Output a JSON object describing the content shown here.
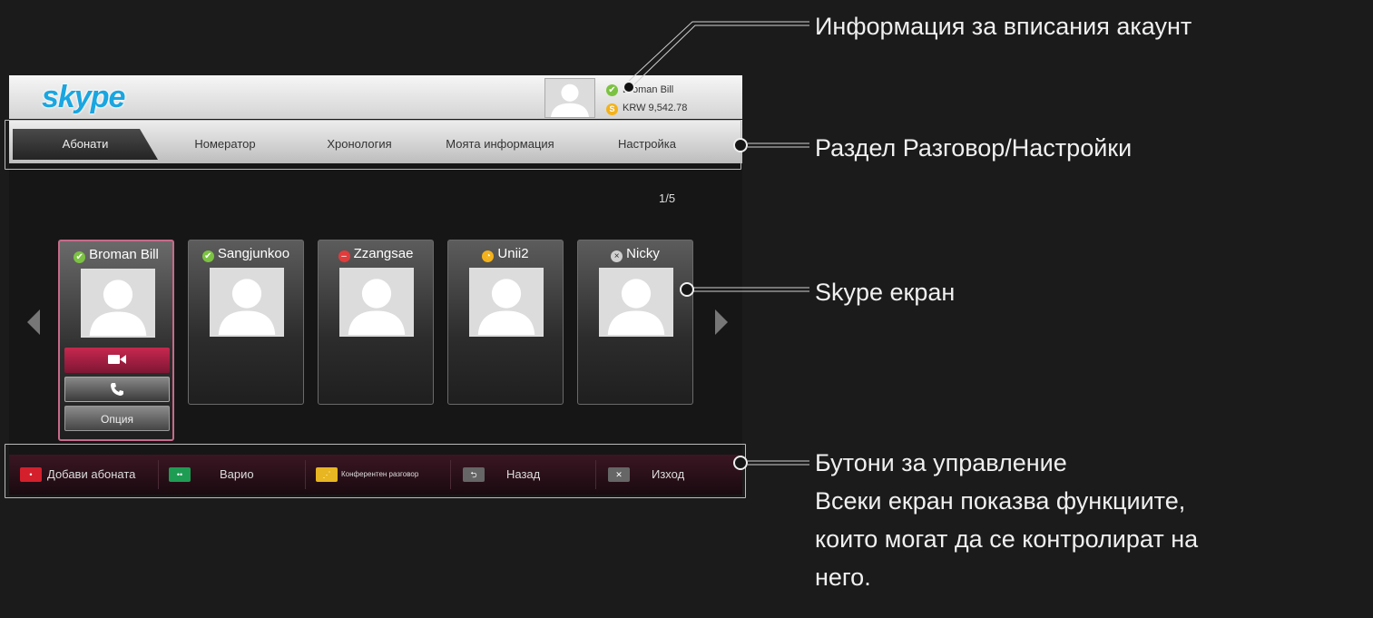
{
  "brand": {
    "logo_text": "skype"
  },
  "account": {
    "name": "Broman Bill",
    "credit": "KRW 9,542.78"
  },
  "tabs": [
    {
      "label": "Абонати",
      "active": true
    },
    {
      "label": "Номератор",
      "active": false
    },
    {
      "label": "Хронология",
      "active": false
    },
    {
      "label": "Моята информация",
      "active": false
    },
    {
      "label": "Настройка",
      "active": false
    }
  ],
  "page_indicator": "1/5",
  "contacts": [
    {
      "name": "Broman Bill",
      "status": "online",
      "status_color": "#7cc242"
    },
    {
      "name": "Sangjunkoo",
      "status": "online",
      "status_color": "#7cc242"
    },
    {
      "name": "Zzangsae",
      "status": "do-not-disturb",
      "status_color": "#e23b3b"
    },
    {
      "name": "Unii2",
      "status": "away",
      "status_color": "#f3b21b"
    },
    {
      "name": "Nicky",
      "status": "offline",
      "status_color": "#cfcfcf"
    }
  ],
  "selected_contact_actions": {
    "video_icon": "video-camera-icon",
    "call_icon": "phone-icon",
    "option_label": "Опция"
  },
  "controls": [
    {
      "key_color": "#d4202c",
      "key_symbol": "•",
      "label": "Добави абоната"
    },
    {
      "key_color": "#1f9c54",
      "key_symbol": "••",
      "label": "Варио"
    },
    {
      "key_color": "#e8b622",
      "key_symbol": "⋰",
      "label": "Конферентен разговор"
    },
    {
      "key_color": "#666666",
      "key_symbol": "⮌",
      "label": "Назад"
    },
    {
      "key_color": "#666666",
      "key_symbol": "✕",
      "label": "Изход"
    }
  ],
  "annotations": {
    "account_info": "Информация за вписания акаунт",
    "section": "Раздел Разговор/Настройки",
    "screen": "Skype екран",
    "controls_title": "Бутони за управление",
    "controls_desc_1": "Всеки екран показва функциите,",
    "controls_desc_2": "които могат да се контролират на",
    "controls_desc_3": "него."
  }
}
